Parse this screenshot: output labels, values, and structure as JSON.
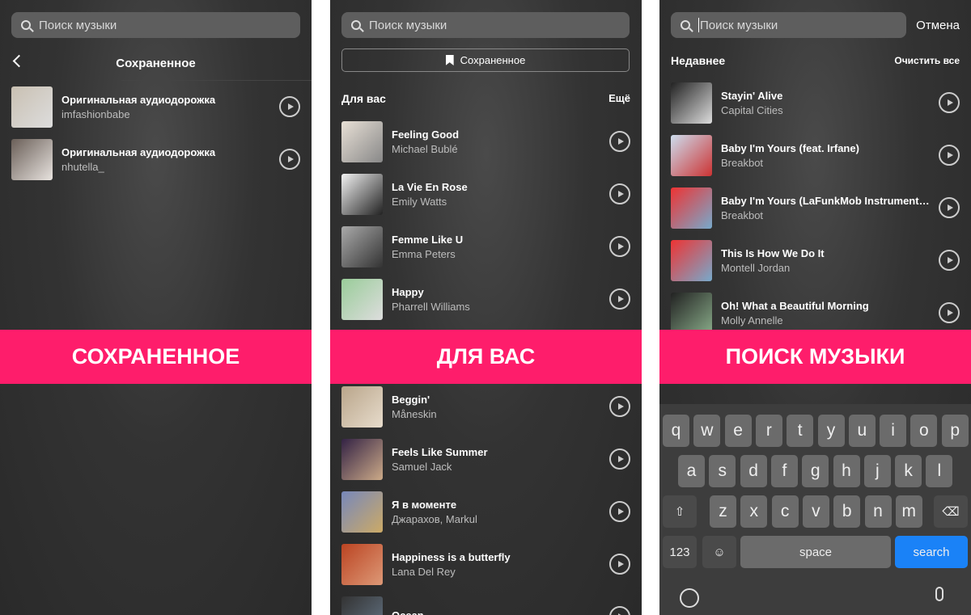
{
  "search_placeholder": "Поиск музыки",
  "panel1": {
    "title": "Сохраненное",
    "banner": "СОХРАНЕННОЕ",
    "items": [
      {
        "title": "Оригинальная аудиодорожка",
        "artist": "imfashionbabe"
      },
      {
        "title": "Оригинальная аудиодорожка",
        "artist": "nhutella_"
      }
    ]
  },
  "panel2": {
    "saved_button": "Сохраненное",
    "section": "Для вас",
    "more": "Ещё",
    "banner": "ДЛЯ ВАС",
    "items": [
      {
        "title": "Feeling Good",
        "artist": "Michael Bublé"
      },
      {
        "title": "La Vie En Rose",
        "artist": "Emily Watts"
      },
      {
        "title": "Femme Like U",
        "artist": "Emma Peters"
      },
      {
        "title": "Happy",
        "artist": "Pharrell Williams"
      },
      {
        "title": "Beggin'",
        "artist": "Måneskin"
      },
      {
        "title": "Feels Like Summer",
        "artist": "Samuel Jack"
      },
      {
        "title": "Я в моменте",
        "artist": "Джарахов, Markul"
      },
      {
        "title": "Happiness is a butterfly",
        "artist": "Lana Del Rey"
      },
      {
        "title": "Ocean",
        "artist": ""
      }
    ]
  },
  "panel3": {
    "cancel": "Отмена",
    "section": "Недавнее",
    "clear": "Очистить все",
    "banner": "ПОИСК МУЗЫКИ",
    "items": [
      {
        "title": "Stayin' Alive",
        "artist": "Capital Cities"
      },
      {
        "title": "Baby I'm Yours (feat. Irfane)",
        "artist": "Breakbot"
      },
      {
        "title": "Baby I'm Yours (LaFunkMob Instrumenta...",
        "artist": "Breakbot"
      },
      {
        "title": "This Is How We Do It",
        "artist": "Montell Jordan"
      },
      {
        "title": "Oh! What a Beautiful Morning",
        "artist": "Molly Annelle"
      }
    ],
    "keyboard": {
      "row1": [
        "q",
        "w",
        "e",
        "r",
        "t",
        "y",
        "u",
        "i",
        "o",
        "p"
      ],
      "row2": [
        "a",
        "s",
        "d",
        "f",
        "g",
        "h",
        "j",
        "k",
        "l"
      ],
      "row3": [
        "z",
        "x",
        "c",
        "v",
        "b",
        "n",
        "m"
      ],
      "numbers": "123",
      "space": "space",
      "search": "search"
    }
  },
  "colors": {
    "accent": "#fe1d6b",
    "search_key": "#1a82f7"
  }
}
